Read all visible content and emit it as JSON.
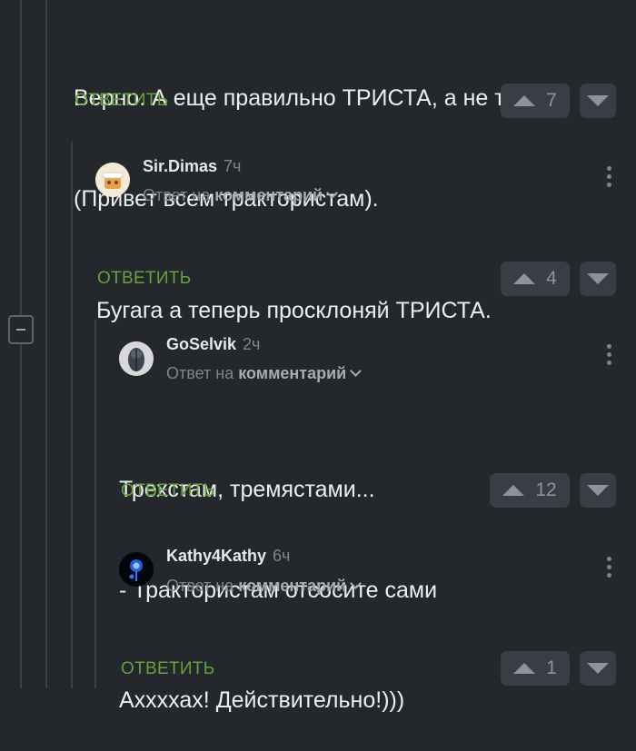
{
  "top_comment": {
    "text_line1": "Верно. А еще правильно ТРИСТА, а не треста.",
    "text_line2": "(Привет всем трактористам).",
    "reply_label": "ОТВЕТИТЬ",
    "rating": "7"
  },
  "comments": [
    {
      "author": "Sir.Dimas",
      "time": "7ч",
      "reply_to_prefix": "Ответ на",
      "reply_to_link": "комментарий",
      "text": [
        "Бугага а теперь просклоняй ТРИСТА."
      ],
      "reply_label": "ОТВЕТИТЬ",
      "rating": "4"
    },
    {
      "author": "GoSelvik",
      "time": "2ч",
      "reply_to_prefix": "Ответ на",
      "reply_to_link": "комментарий",
      "text": [
        "Трехстам, тремястами...",
        "- Трактористам отсосите сами"
      ],
      "reply_label": "ОТВЕТИТЬ",
      "rating": "12"
    },
    {
      "author": "Kathy4Kathy",
      "time": "6ч",
      "reply_to_prefix": "Ответ на",
      "reply_to_link": "комментарий",
      "text": [
        "Аххххах! Действительно!)))"
      ],
      "reply_label": "ОТВЕТИТЬ",
      "rating": "1"
    }
  ],
  "colors": {
    "background": "#24272b",
    "reply_accent": "#62a33c",
    "vote_bg": "#3a3e44",
    "muted_text": "#7f858c"
  },
  "icons": {
    "upvote": "triangle-up-icon",
    "downvote": "triangle-down-icon",
    "menu": "kebab-menu-icon",
    "collapse": "minus-icon",
    "dropdown": "chevron-down-icon"
  }
}
